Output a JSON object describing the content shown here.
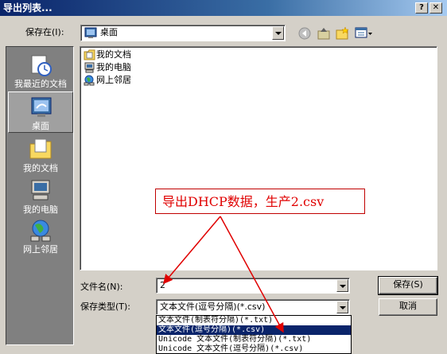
{
  "window": {
    "title": "导出列表...",
    "help_label": "?",
    "close_label": "✕"
  },
  "toolbar": {
    "save_in_label": "保存在(I):",
    "location_value": "桌面",
    "icons": [
      "back-icon",
      "up-folder-icon",
      "new-folder-icon",
      "view-menu-icon"
    ]
  },
  "places": [
    {
      "label": "我最近的文档",
      "icon": "recent-documents-icon",
      "active": false
    },
    {
      "label": "桌面",
      "icon": "desktop-icon",
      "active": true
    },
    {
      "label": "我的文档",
      "icon": "my-documents-icon",
      "active": false
    },
    {
      "label": "我的电脑",
      "icon": "my-computer-icon",
      "active": false
    },
    {
      "label": "网上邻居",
      "icon": "network-places-icon",
      "active": false
    }
  ],
  "files": [
    {
      "name": "我的文档",
      "icon": "folder-documents-icon"
    },
    {
      "name": "我的电脑",
      "icon": "computer-icon"
    },
    {
      "name": "网上邻居",
      "icon": "network-icon"
    }
  ],
  "form": {
    "filename_label": "文件名(N):",
    "filename_value": "2",
    "filetype_label": "保存类型(T):",
    "filetype_value": "文本文件(逗号分隔)(*.csv)",
    "filetype_options": [
      "文本文件(制表符分隔)(*.txt)",
      "文本文件(逗号分隔)(*.csv)",
      "Unicode 文本文件(制表符分隔)(*.txt)",
      "Unicode 文本文件(逗号分隔)(*.csv)"
    ],
    "selected_option_index": 1
  },
  "buttons": {
    "save_label": "保存(S)",
    "cancel_label": "取消"
  },
  "annotation": {
    "text": "导出DHCP数据，生产2.csv",
    "color": "#e00000"
  }
}
